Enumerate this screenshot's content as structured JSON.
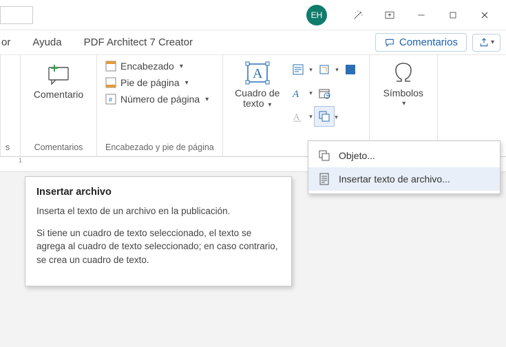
{
  "titlebar": {
    "avatar_initials": "EH"
  },
  "tabs": {
    "t1": "or",
    "t2": "Ayuda",
    "t3": "PDF Architect 7 Creator",
    "comments_btn": "Comentarios"
  },
  "ribbon": {
    "group_comentarios": {
      "label": "Comentarios",
      "btn": "Comentario"
    },
    "group_encpie": {
      "label": "Encabezado y pie de página",
      "enc": "Encabezado",
      "pie": "Pie de página",
      "num": "Número de página"
    },
    "group_texto": {
      "label": "Cuadro de",
      "label2": "texto"
    },
    "group_simbolos": {
      "label": "Símbolos"
    }
  },
  "dropdown": {
    "item1": "Objeto...",
    "item2": "Insertar texto de archivo..."
  },
  "tooltip": {
    "title": "Insertar archivo",
    "p1": "Inserta el texto de un archivo en la publicación.",
    "p2": "Si tiene un cuadro de texto seleccionado, el texto se agrega al cuadro de texto seleccionado; en caso contrario, se crea un cuadro de texto."
  },
  "ruler": {
    "mark": "1"
  }
}
